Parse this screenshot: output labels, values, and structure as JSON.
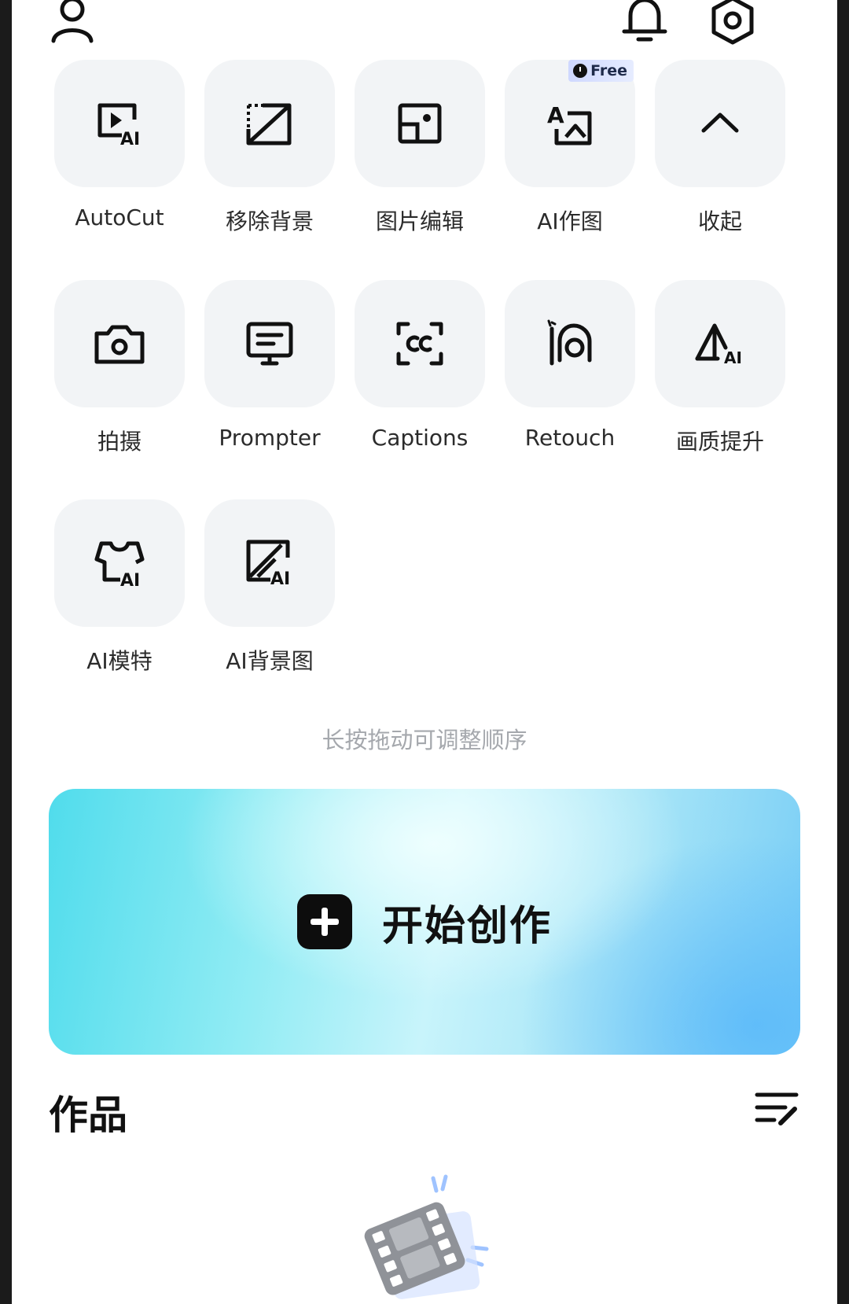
{
  "header": {
    "profile_icon": "person-icon",
    "notification_icon": "bell-icon",
    "settings_icon": "hexagon-settings-icon"
  },
  "tools": [
    {
      "label": "AutoCut",
      "icon": "autocut-play-ai-icon"
    },
    {
      "label": "移除背景",
      "icon": "remove-background-icon"
    },
    {
      "label": "图片编辑",
      "icon": "image-edit-icon"
    },
    {
      "label": "AI作图",
      "icon": "ai-draw-icon",
      "badge": "Free"
    },
    {
      "label": "收起",
      "icon": "chevron-up-icon"
    },
    {
      "label": "拍摄",
      "icon": "camera-icon"
    },
    {
      "label": "Prompter",
      "icon": "prompter-icon"
    },
    {
      "label": "Captions",
      "icon": "captions-icon"
    },
    {
      "label": "Retouch",
      "icon": "retouch-icon"
    },
    {
      "label": "画质提升",
      "icon": "quality-boost-ai-icon"
    },
    {
      "label": "AI模特",
      "icon": "ai-model-shirt-icon"
    },
    {
      "label": "AI背景图",
      "icon": "ai-background-icon"
    }
  ],
  "hint": "长按拖动可调整顺序",
  "create_button": {
    "label": "开始创作",
    "icon": "plus-square-icon"
  },
  "works": {
    "title": "作品",
    "sort_icon": "list-edit-icon",
    "empty_icon": "film-reel-icon"
  },
  "colors": {
    "tile_bg": "#f2f4f6",
    "gradient_start": "#50dcec",
    "gradient_end": "#78cdf6"
  }
}
